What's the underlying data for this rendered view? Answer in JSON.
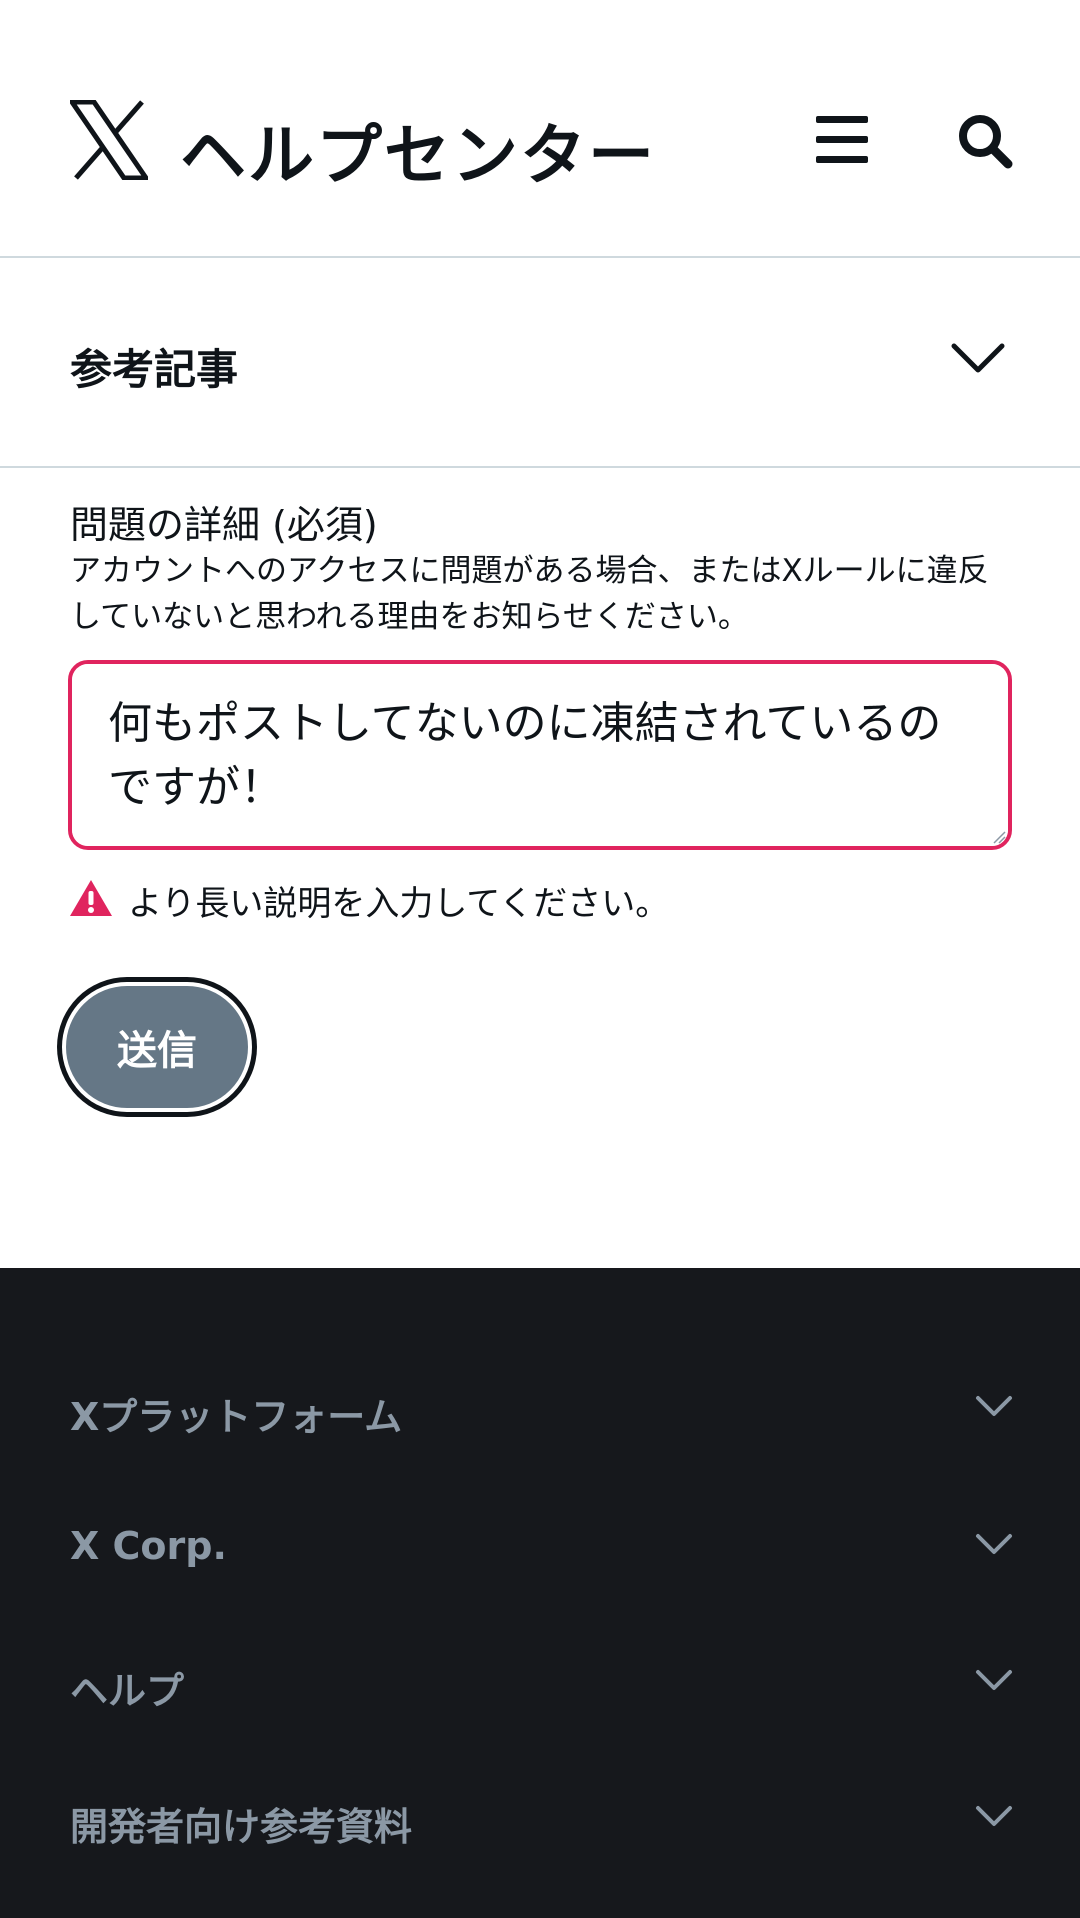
{
  "header": {
    "title": "ヘルプセンター",
    "logo_icon": "x-logo-icon",
    "menu_icon": "hamburger-menu-icon",
    "search_icon": "search-icon"
  },
  "related_articles": {
    "label": "参考記事",
    "icon": "chevron-down-icon"
  },
  "form": {
    "field_label": "問題の詳細 (必須)",
    "help_text": "アカウントへのアクセスに問題がある場合、またはXルールに違反していないと思われる理由をお知らせください。",
    "textarea_value": "何もポストしてないのに凍結されているのですが！",
    "error_icon": "warning-icon",
    "error_message": "より長い説明を入力してください。",
    "submit_label": "送信"
  },
  "colors": {
    "error": "#e0245e",
    "button_bg": "#657786",
    "footer_bg": "#16181c",
    "footer_text": "#8b98a5"
  },
  "footer": {
    "items": [
      {
        "label": "Xプラットフォーム"
      },
      {
        "label": "X Corp."
      },
      {
        "label": "ヘルプ"
      },
      {
        "label": "開発者向け参考資料"
      }
    ]
  }
}
